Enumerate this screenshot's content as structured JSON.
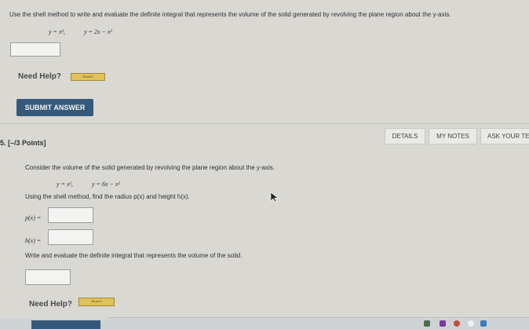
{
  "prev_question": {
    "prompt": "Use the shell method to write and evaluate the definite integral that represents the volume of the solid generated by revolving the plane region about the y-axis.",
    "eq1": "y = x²,",
    "eq2": "y = 2x − x²",
    "need_help": "Need Help?",
    "read_it": "Read It",
    "submit": "SUBMIT ANSWER"
  },
  "question": {
    "number": "5. [–/3 Points]",
    "tabs": [
      "DETAILS",
      "MY NOTES",
      "ASK YOUR TE"
    ],
    "intro": "Consider the volume of the solid generated by revolving the plane region about the y-axis.",
    "eq1": "y = x²,",
    "eq2": "y = 6x − x²",
    "instruction": "Using the shell method, find the radius p(x) and height h(x).",
    "p_label": "p(x) =",
    "h_label": "h(x) =",
    "write_eval": "Write and evaluate the definite integral that represents the volume of the solid.",
    "need_help": "Need Help?",
    "read_it": "Read It"
  },
  "colors": {
    "accent": "#35597a",
    "read_button": "#e0c15a"
  }
}
